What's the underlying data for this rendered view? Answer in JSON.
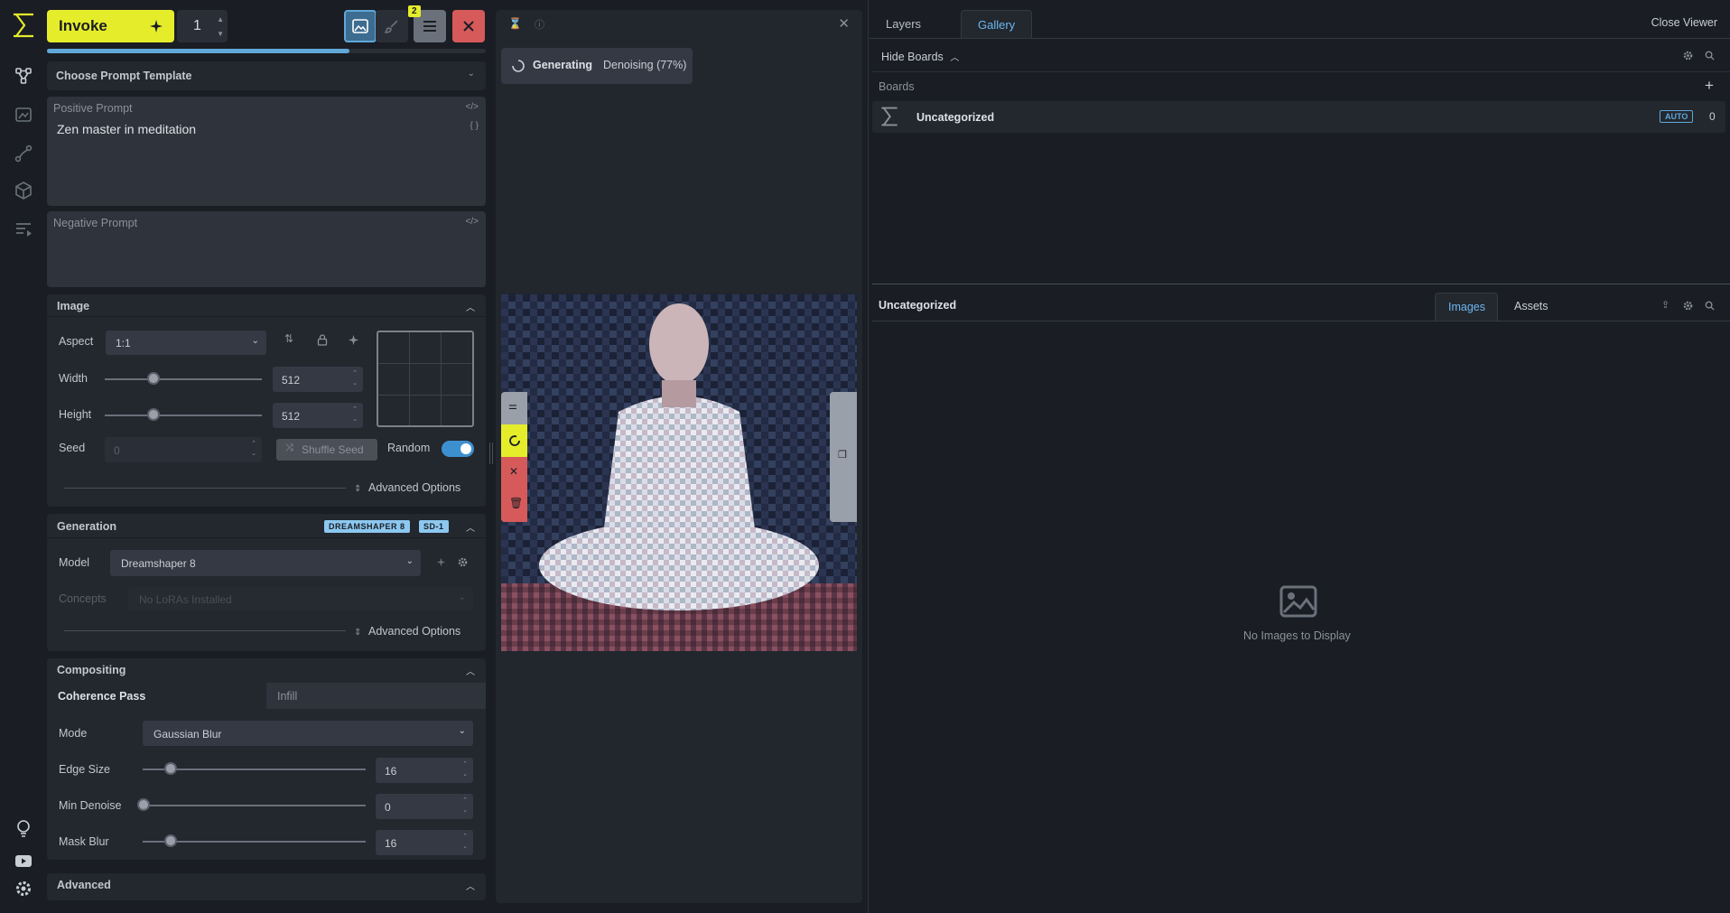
{
  "app": {
    "brand_color": "#e5ed2b",
    "accent": "#5fa8d8"
  },
  "nav": {
    "items": [
      {
        "name": "canvas-icon"
      },
      {
        "name": "upscale-icon"
      },
      {
        "name": "workflow-icon"
      },
      {
        "name": "models-icon"
      },
      {
        "name": "queue-icon"
      }
    ],
    "bottom": [
      {
        "name": "lightbulb-icon"
      },
      {
        "name": "youtube-icon"
      },
      {
        "name": "settings-gear-icon"
      }
    ]
  },
  "toolbar": {
    "invoke_label": "Invoke",
    "iterations": "1",
    "badge": "2"
  },
  "progress": {
    "fraction": 0.69
  },
  "prompt_template": {
    "label": "Choose Prompt Template"
  },
  "positive_prompt": {
    "label": "Positive Prompt",
    "value": "Zen master in meditation"
  },
  "negative_prompt": {
    "label": "Negative Prompt",
    "value": ""
  },
  "image": {
    "title": "Image",
    "aspect_label": "Aspect",
    "aspect_value": "1:1",
    "width_label": "Width",
    "width_value": "512",
    "height_label": "Height",
    "height_value": "512",
    "seed_label": "Seed",
    "seed_value": "0",
    "shuffle_label": "Shuffle Seed",
    "random_label": "Random",
    "advanced_label": "Advanced Options"
  },
  "generation": {
    "title": "Generation",
    "tag1": "DREAMSHAPER 8",
    "tag2": "SD-1",
    "model_label": "Model",
    "model_value": "Dreamshaper 8",
    "concepts_label": "Concepts",
    "concepts_placeholder": "No LoRAs Installed",
    "advanced_label": "Advanced Options"
  },
  "compositing": {
    "title": "Compositing",
    "tab_coherence": "Coherence Pass",
    "tab_infill": "Infill",
    "mode_label": "Mode",
    "mode_value": "Gaussian Blur",
    "edge_label": "Edge Size",
    "edge_value": "16",
    "min_denoise_label": "Min Denoise",
    "min_denoise_value": "0",
    "mask_blur_label": "Mask Blur",
    "mask_blur_value": "16"
  },
  "advanced": {
    "title": "Advanced"
  },
  "viewer": {
    "status_strong": "Generating",
    "status_detail": "Denoising (77%)"
  },
  "right": {
    "tab_layers": "Layers",
    "tab_gallery": "Gallery",
    "close_viewer": "Close Viewer",
    "hide_boards": "Hide Boards",
    "boards_label": "Boards",
    "board_name": "Uncategorized",
    "board_auto": "AUTO",
    "board_count": "0",
    "gallery_title": "Uncategorized",
    "tab_images": "Images",
    "tab_assets": "Assets",
    "empty": "No Images to Display"
  }
}
